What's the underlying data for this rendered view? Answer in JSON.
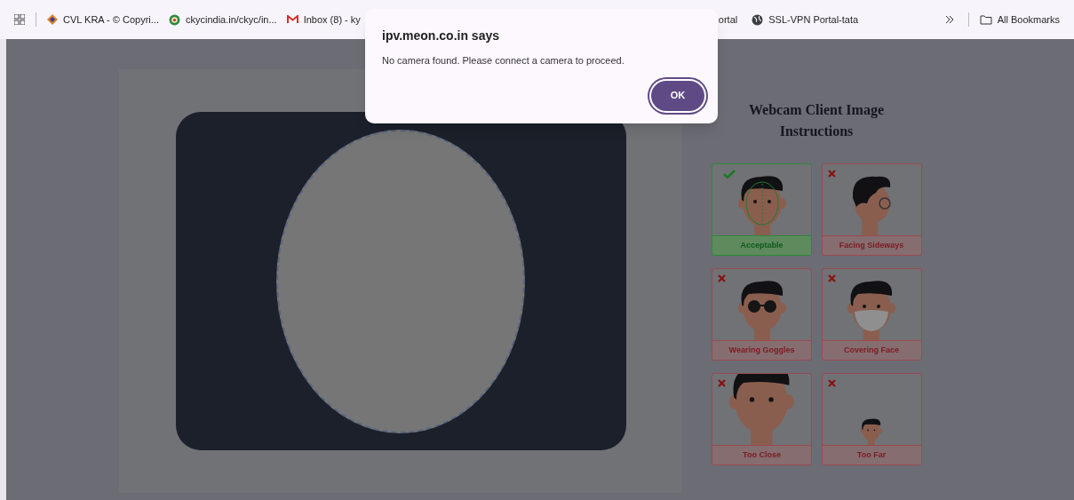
{
  "bookmarks_bar": {
    "items": [
      {
        "label": "CVL KRA - © Copyri...",
        "kind": "kra"
      },
      {
        "label": "ckycindia.in/ckyc/in...",
        "kind": "site"
      },
      {
        "label": "Inbox (8) - ky",
        "kind": "mail"
      },
      {
        "label": "ortal",
        "kind": "none"
      },
      {
        "label": "SSL-VPN Portal-tata",
        "kind": "globe"
      }
    ],
    "all_bookmarks": "All Bookmarks"
  },
  "dialog": {
    "title": "ipv.meon.co.in says",
    "message": "No camera found. Please connect a camera to proceed.",
    "button": "OK"
  },
  "instructions": {
    "title": "Webcam Client Image Instructions",
    "cards": [
      {
        "label": "Acceptable",
        "acceptable": true,
        "kind": "front"
      },
      {
        "label": "Facing Sideways",
        "acceptable": false,
        "kind": "side"
      },
      {
        "label": "Wearing Goggles",
        "acceptable": false,
        "kind": "goggles"
      },
      {
        "label": "Covering Face",
        "acceptable": false,
        "kind": "mask"
      },
      {
        "label": "Too Close",
        "acceptable": false,
        "kind": "close"
      },
      {
        "label": "Too Far",
        "acceptable": false,
        "kind": "far"
      }
    ]
  }
}
